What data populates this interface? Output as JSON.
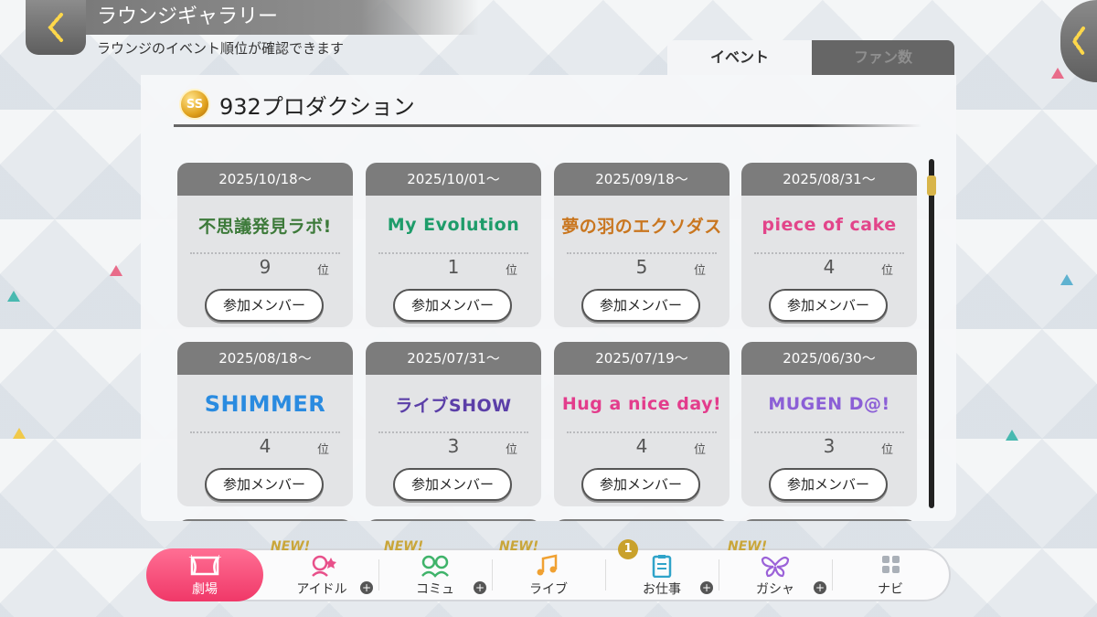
{
  "header": {
    "title": "ラウンジギャラリー",
    "subtitle": "ラウンジのイベント順位が確認できます"
  },
  "tabs": [
    {
      "label": "イベント",
      "active": true
    },
    {
      "label": "ファン数",
      "active": false
    }
  ],
  "production": {
    "badge": "SS",
    "name": "932プロダクション"
  },
  "rank_suffix": "位",
  "events": [
    {
      "date": "2025/10/18～",
      "logo_text": "不思議発見ラボ!",
      "rank": "9",
      "button": "参加メンバー",
      "color": "#3d7a3a"
    },
    {
      "date": "2025/10/01～",
      "logo_text": "My Evolution",
      "rank": "1",
      "button": "参加メンバー",
      "color": "#1e9c6a"
    },
    {
      "date": "2025/09/18～",
      "logo_text": "夢の羽のエクソダス",
      "rank": "5",
      "button": "参加メンバー",
      "color": "#c9761f"
    },
    {
      "date": "2025/08/31～",
      "logo_text": "piece of cake",
      "rank": "4",
      "button": "参加メンバー",
      "color": "#e2458a"
    },
    {
      "date": "2025/08/18～",
      "logo_text": "SHIMMER",
      "rank": "4",
      "button": "参加メンバー",
      "color": "#2a8be0"
    },
    {
      "date": "2025/07/31～",
      "logo_text": "ライブSHOW",
      "rank": "3",
      "button": "参加メンバー",
      "color": "#5b3fa8"
    },
    {
      "date": "2025/07/19～",
      "logo_text": "Hug a nice day!",
      "rank": "4",
      "button": "参加メンバー",
      "color": "#e33c8c"
    },
    {
      "date": "2025/06/30～",
      "logo_text": "MUGEN D@!",
      "rank": "3",
      "button": "参加メンバー",
      "color": "#8b5fd6"
    }
  ],
  "nav": {
    "home": {
      "label": "劇場",
      "icon": "theater-icon"
    },
    "items": [
      {
        "label": "アイドル",
        "icon": "idol-icon",
        "new": "NEW!",
        "plus": "+"
      },
      {
        "label": "コミュ",
        "icon": "commu-icon",
        "new": "NEW!",
        "plus": "+"
      },
      {
        "label": "ライブ",
        "icon": "live-icon",
        "new": "NEW!",
        "plus": ""
      },
      {
        "label": "お仕事",
        "icon": "work-icon",
        "badge": "1",
        "plus": "+"
      },
      {
        "label": "ガシャ",
        "icon": "gacha-icon",
        "new": "NEW!",
        "plus": "+"
      },
      {
        "label": "ナビ",
        "icon": "navi-icon",
        "plus": ""
      }
    ]
  },
  "colors": {
    "accent": "#f03868",
    "header_gray": "#7c7c7c",
    "gold": "#c9a12b"
  }
}
